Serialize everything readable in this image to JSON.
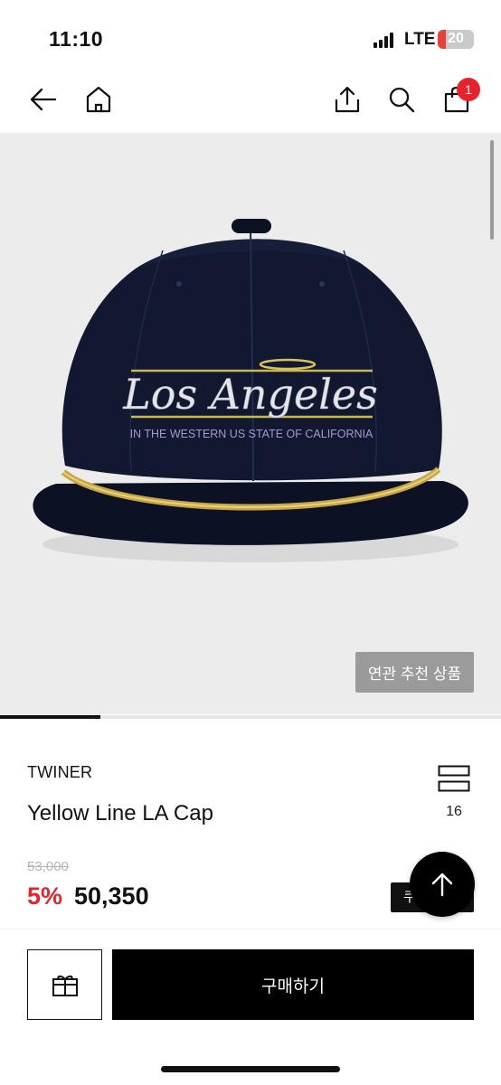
{
  "status_bar": {
    "time": "11:10",
    "network": "LTE",
    "battery": "20"
  },
  "nav": {
    "icons": [
      "back-arrow-icon",
      "home-icon",
      "share-icon",
      "search-icon",
      "shopping-bag-icon"
    ],
    "cart_badge": "1"
  },
  "product_image": {
    "hat_text_main": "Los Angeles",
    "hat_text_sub": "IN THE WESTERN US STATE OF CALIFORNIA",
    "related_button": "연관 추천 상품",
    "carousel_progress": 0.2
  },
  "product": {
    "brand": "TWINER",
    "name": "Yellow Line LA Cap",
    "original_price": "53,000",
    "discount": "5%",
    "price": "50,350",
    "compare_count": "16",
    "coupon_label": "쿠"
  },
  "bottom_bar": {
    "buy_label": "구매하기"
  },
  "colors": {
    "accent_red": "#e8222a",
    "black": "#000000",
    "image_bg": "#ececec"
  }
}
